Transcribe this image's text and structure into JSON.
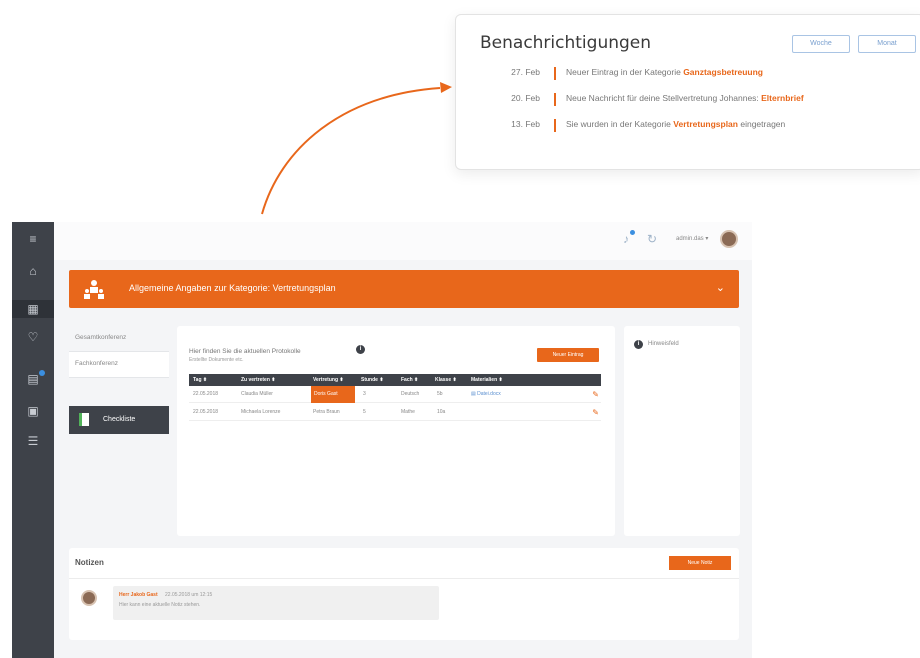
{
  "notifications": {
    "title": "Benachrichtigungen",
    "buttons": [
      "Woche",
      "Monat"
    ],
    "items": [
      {
        "date": "27. Feb",
        "text": "Neuer Eintrag in der Kategorie ",
        "highlight": "Ganztagsbetreuung",
        "suffix": ""
      },
      {
        "date": "20. Feb",
        "text": "Neue Nachricht für deine Stellvertretung Johannes: ",
        "highlight": "Elternbrief",
        "suffix": ""
      },
      {
        "date": "13. Feb",
        "text": "Sie wurden in der Kategorie ",
        "highlight": "Vertretungsplan",
        "suffix": " eingetragen"
      }
    ]
  },
  "app": {
    "user": {
      "name": "admin.das"
    },
    "sidebar_icons": [
      "menu-icon",
      "home-icon",
      "grid-icon",
      "heart-icon",
      "chart-icon",
      "document-icon",
      "list-icon"
    ],
    "banner": {
      "title": "Allgemeine Angaben zur Kategorie: Vertretungsplan"
    },
    "left_nav": {
      "items": [
        "Gesamtkonferenz",
        "Fachkonferenz"
      ],
      "checklist_label": "Checkliste"
    },
    "panel": {
      "hint": "Hier finden Sie die aktuellen Protokolle",
      "sub": "Erstellte Dokumente etc.",
      "new_entry": "Neuer Eintrag",
      "columns": [
        "Tag ⬍",
        "Zu vertreten ⬍",
        "Vertretung ⬍",
        "Stunde ⬍",
        "Fach ⬍",
        "Klasse ⬍",
        "Materialien ⬍"
      ],
      "rows": [
        {
          "tag": "22.05.2018",
          "zu_vertreten": "Claudia Müller",
          "vertretung": "Doris Gast",
          "stunde": "3",
          "fach": "Deutsch",
          "klasse": "5b",
          "material": "Datei.docx"
        },
        {
          "tag": "22.05.2018",
          "zu_vertreten": "Michaela Lorenze",
          "vertretung": "Petra Braun",
          "stunde": "5",
          "fach": "Mathe",
          "klasse": "10a",
          "material": ""
        }
      ]
    },
    "side_panel": {
      "title": "Hinweisfeld"
    },
    "notes": {
      "title": "Notizen",
      "new_note": "Neue Notiz",
      "entries": [
        {
          "author": "Herr Jakob Gast",
          "date": "22.05.2018 um 12:15",
          "text": "Hier kann eine aktuelle Notiz stehen."
        }
      ]
    }
  },
  "colors": {
    "accent": "#e8671b",
    "sidebar": "#3e4249",
    "link": "#5a8fd0"
  }
}
